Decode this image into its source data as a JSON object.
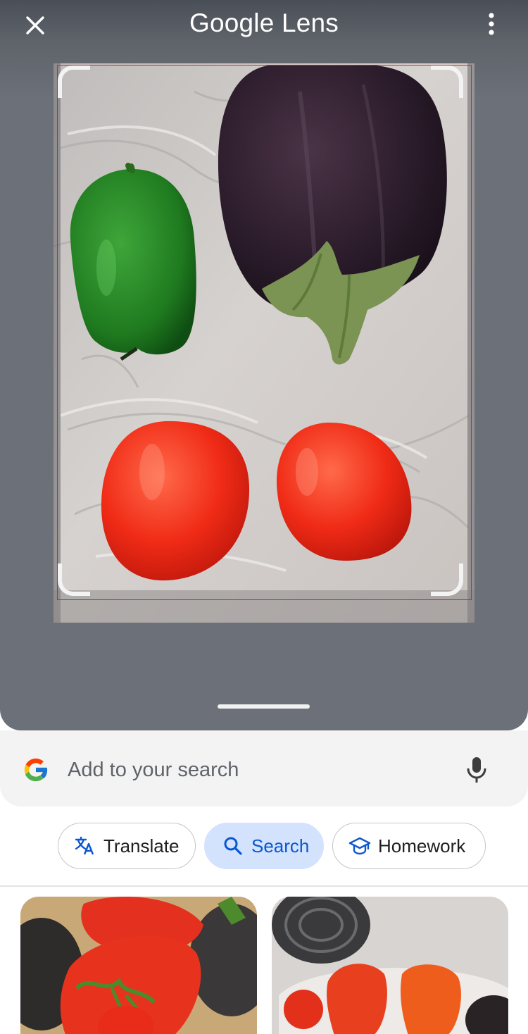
{
  "header": {
    "brand": "Google",
    "product": "Lens",
    "close_icon": "close-icon",
    "menu_icon": "more-vert-icon"
  },
  "photo": {
    "subject_icon": "vegetables-photo"
  },
  "search": {
    "placeholder": "Add to your search",
    "logo_icon": "google-g-icon",
    "mic_icon": "microphone-icon"
  },
  "chips": [
    {
      "label": "Translate",
      "icon": "translate-icon"
    },
    {
      "label": "Search",
      "icon": "search-icon"
    },
    {
      "label": "Homework",
      "icon": "graduation-cap-icon"
    }
  ],
  "colors": {
    "selected_chip_bg": "#d3e3fd",
    "selected_chip_text": "#0b57d0",
    "crop_outline": "#d1222b",
    "viewer_bg": "#6b7079"
  }
}
